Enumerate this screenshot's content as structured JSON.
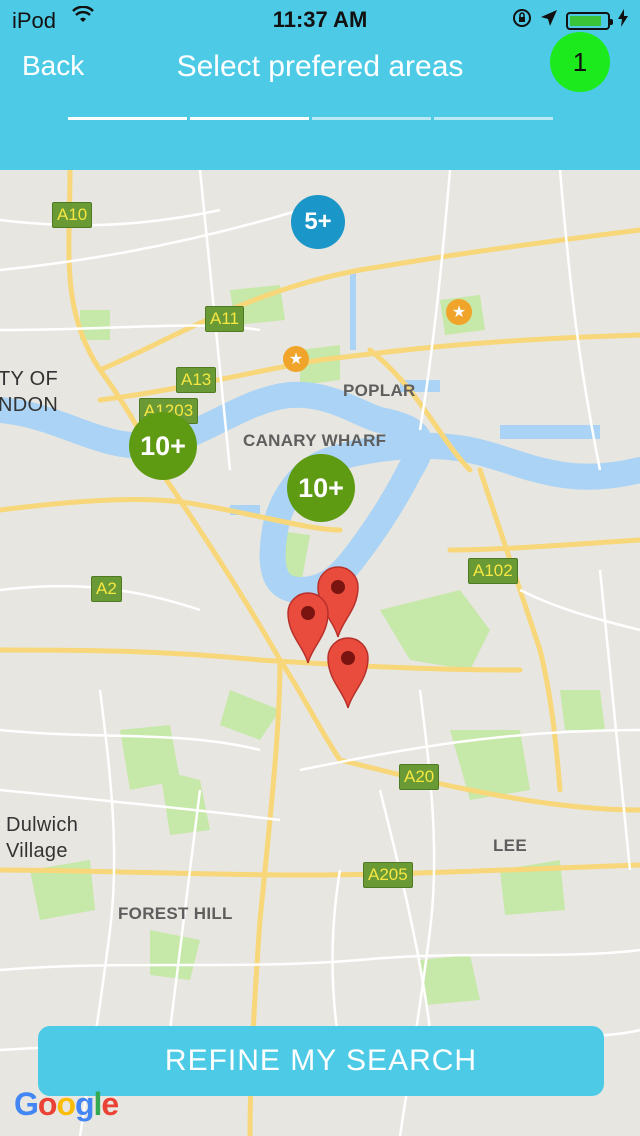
{
  "status_bar": {
    "device": "iPod",
    "time": "11:37 AM",
    "battery_level": 0.85,
    "battery_color": "#3ac43a"
  },
  "nav": {
    "back_label": "Back",
    "title": "Select prefered areas",
    "badge_count": "1"
  },
  "progress": {
    "total_steps": 4,
    "completed_steps": 2
  },
  "map": {
    "road_labels": [
      "A10",
      "A11",
      "A13",
      "A1203",
      "A2",
      "A102",
      "A20",
      "A205"
    ],
    "places": {
      "city": "TY OF\nNDON",
      "poplar": "POPLAR",
      "canary_wharf": "CANARY WHARF",
      "dulwich": "Dulwich\nVillage",
      "lee": "LEE",
      "forest_hill": "FOREST HILL"
    },
    "clusters": {
      "blue": "5+",
      "green_left": "10+",
      "green_right": "10+"
    },
    "markers_count": 3,
    "colors": {
      "water": "#aad3f5",
      "park": "#c6e8a8",
      "road_major": "#f7d77a",
      "cluster_green": "#5e9a12",
      "cluster_blue": "#1a96c8",
      "marker": "#e94b3c"
    }
  },
  "refine_button": {
    "label": "REFINE MY SEARCH"
  },
  "attribution": {
    "letters": [
      "G",
      "o",
      "o",
      "g",
      "l",
      "e"
    ]
  },
  "icons": [
    "wifi-icon",
    "lock-rotation-icon",
    "location-arrow-icon",
    "battery-icon",
    "charging-icon",
    "star-icon",
    "map-pin-icon"
  ]
}
